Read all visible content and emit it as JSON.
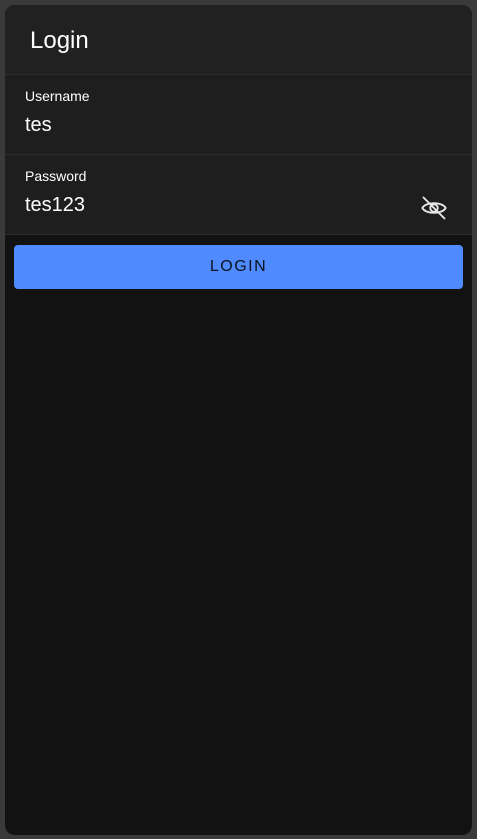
{
  "header": {
    "title": "Login"
  },
  "form": {
    "username": {
      "label": "Username",
      "value": "tes"
    },
    "password": {
      "label": "Password",
      "value": "tes123",
      "toggle_icon": "eye-off-icon"
    },
    "submit_label": "LOGIN"
  },
  "colors": {
    "accent": "#4f8bff",
    "background": "#121212",
    "surface": "#1e1e1e",
    "toolbar": "#212121"
  }
}
